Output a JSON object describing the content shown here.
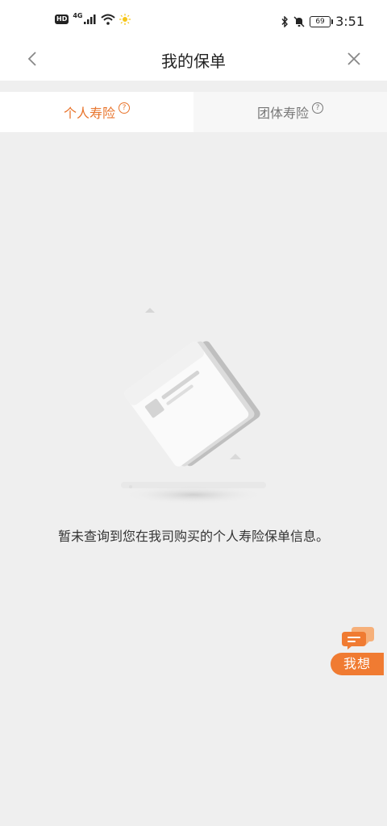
{
  "status_bar": {
    "hd_badge": "HD",
    "network_type": "4G",
    "battery_level": "69",
    "time": "3:51",
    "icons": [
      "signal-icon",
      "wifi-icon",
      "brightness-icon",
      "bluetooth-icon",
      "mute-icon",
      "battery-icon"
    ]
  },
  "nav": {
    "title": "我的保单",
    "back_icon": "chevron-left-icon",
    "close_icon": "close-icon"
  },
  "tabs": [
    {
      "label": "个人寿险",
      "active": true
    },
    {
      "label": "团体寿险",
      "active": false
    }
  ],
  "tab_help_symbol": "?",
  "empty_state": {
    "icon": "empty-document-icon",
    "message": "暂未查询到您在我司购买的个人寿险保单信息。"
  },
  "assistant": {
    "label": "我想",
    "icon": "chat-bubble-icon"
  },
  "colors": {
    "accent": "#e8732a",
    "fab": "#f07b32",
    "background": "#efefef"
  }
}
